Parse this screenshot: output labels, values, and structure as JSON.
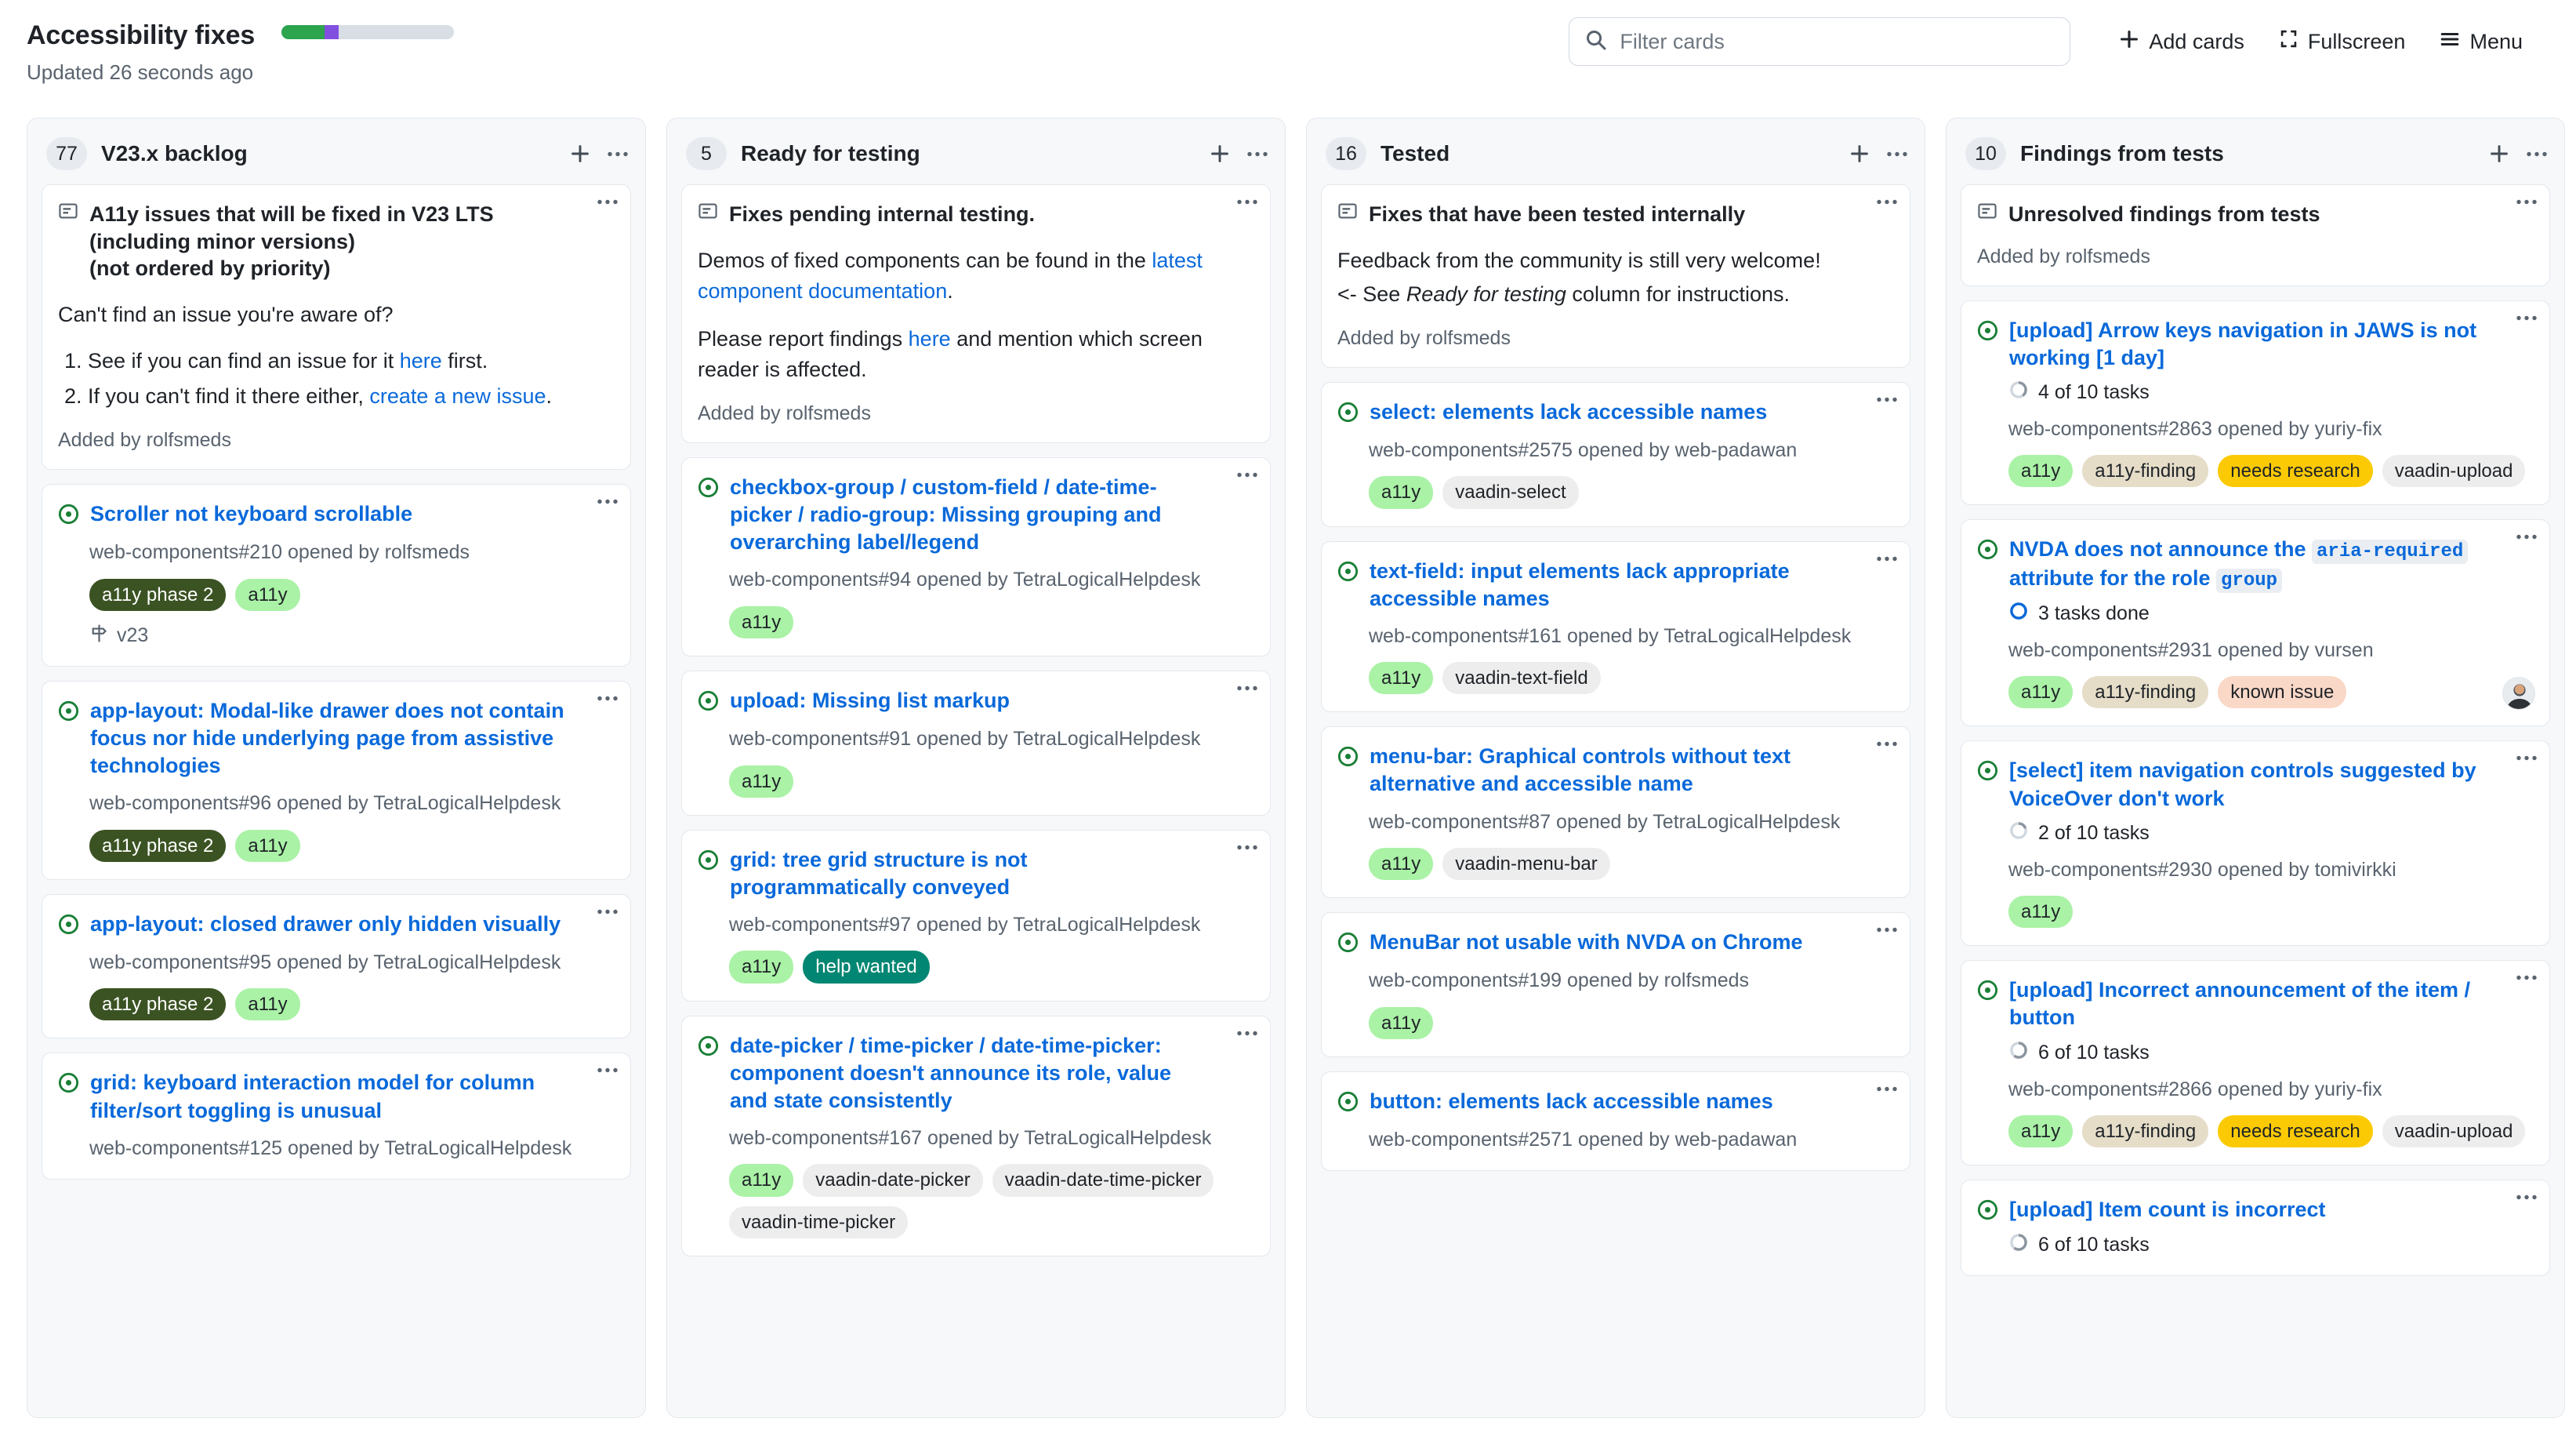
{
  "header": {
    "project_title": "Accessibility fixes",
    "updated_text": "Updated 26 seconds ago",
    "progress": [
      {
        "name": "done",
        "color": "#2da44e",
        "percent": 25
      },
      {
        "name": "in-progress",
        "color": "#8250df",
        "percent": 8
      },
      {
        "name": "remaining",
        "color": "#d8dee4",
        "percent": 67
      }
    ],
    "search": {
      "placeholder": "Filter cards",
      "value": ""
    },
    "add_cards_label": "Add cards",
    "fullscreen_label": "Fullscreen",
    "menu_label": "Menu"
  },
  "colors": {
    "link": "#0969da",
    "a11y_bg": "#aaf2a6",
    "a11y_phase2_bg": "#3b5323",
    "a11y_phase2_fg": "#ffffff",
    "help_wanted_bg": "#008672",
    "help_wanted_fg": "#ffffff",
    "a11y_finding_bg": "#e5ddc8",
    "needs_research_bg": "#fbca04",
    "known_issue_bg": "#fad8c7",
    "component_bg": "#ededed"
  },
  "columns": [
    {
      "count": "77",
      "name": "V23.x backlog",
      "cards": [
        {
          "type": "note",
          "title": "A11y issues that will be fixed in V23 LTS",
          "lines": [
            "(including minor versions)",
            "(not ordered by priority)"
          ],
          "question": "Can't find an issue you're aware of?",
          "list": [
            {
              "pre": "See if you can find an issue for it ",
              "link": "here",
              "post": " first."
            },
            {
              "pre": "If you can't find it there either, ",
              "link": "create a new issue",
              "post": "."
            }
          ],
          "added_by": "Added by rolfsmeds"
        },
        {
          "type": "issue",
          "title": "Scroller not keyboard scrollable",
          "meta": "web-components#210 opened by rolfsmeds",
          "labels": [
            {
              "text": "a11y phase 2",
              "style": "phase2"
            },
            {
              "text": "a11y",
              "style": "a11y"
            }
          ],
          "milestone": "v23"
        },
        {
          "type": "issue",
          "title": "app-layout: Modal-like drawer does not contain focus nor hide underlying page from assistive technologies",
          "meta": "web-components#96 opened by TetraLogicalHelpdesk",
          "labels": [
            {
              "text": "a11y phase 2",
              "style": "phase2"
            },
            {
              "text": "a11y",
              "style": "a11y"
            }
          ]
        },
        {
          "type": "issue",
          "title": "app-layout: closed drawer only hidden visually",
          "meta": "web-components#95 opened by TetraLogicalHelpdesk",
          "labels": [
            {
              "text": "a11y phase 2",
              "style": "phase2"
            },
            {
              "text": "a11y",
              "style": "a11y"
            }
          ]
        },
        {
          "type": "issue",
          "title": "grid: keyboard interaction model for column filter/sort toggling is unusual",
          "meta": "web-components#125 opened by TetraLogicalHelpdesk",
          "labels": []
        }
      ]
    },
    {
      "count": "5",
      "name": "Ready for testing",
      "cards": [
        {
          "type": "note",
          "title": "Fixes pending internal testing.",
          "lines": [],
          "para1_pre": "Demos of fixed components can be found in the ",
          "para1_link": "latest component documentation",
          "para1_post": ".",
          "para2_pre": "Please report findings ",
          "para2_link": "here",
          "para2_post": " and mention which screen reader is affected.",
          "added_by": "Added by rolfsmeds"
        },
        {
          "type": "issue",
          "title": "checkbox-group / custom-field / date-time-picker / radio-group: Missing grouping and overarching label/legend",
          "meta": "web-components#94 opened by TetraLogicalHelpdesk",
          "labels": [
            {
              "text": "a11y",
              "style": "a11y"
            }
          ]
        },
        {
          "type": "issue",
          "title": "upload: Missing list markup",
          "meta": "web-components#91 opened by TetraLogicalHelpdesk",
          "labels": [
            {
              "text": "a11y",
              "style": "a11y"
            }
          ]
        },
        {
          "type": "issue",
          "title": "grid: tree grid structure is not programmatically conveyed",
          "meta": "web-components#97 opened by TetraLogicalHelpdesk",
          "labels": [
            {
              "text": "a11y",
              "style": "a11y"
            },
            {
              "text": "help wanted",
              "style": "help"
            }
          ]
        },
        {
          "type": "issue",
          "title": "date-picker / time-picker / date-time-picker: component doesn't announce its role, value and state consistently",
          "meta": "web-components#167 opened by TetraLogicalHelpdesk",
          "labels": [
            {
              "text": "a11y",
              "style": "a11y"
            },
            {
              "text": "vaadin-date-picker",
              "style": "component"
            },
            {
              "text": "vaadin-date-time-picker",
              "style": "component"
            },
            {
              "text": "vaadin-time-picker",
              "style": "component"
            }
          ]
        }
      ]
    },
    {
      "count": "16",
      "name": "Tested",
      "cards": [
        {
          "type": "note",
          "title": "Fixes that have been tested internally",
          "lines": [],
          "plain1": "Feedback from the community is still very welcome!",
          "plain2_pre": "<- See ",
          "plain2_em": "Ready for testing",
          "plain2_post": " column for instructions.",
          "added_by": "Added by rolfsmeds"
        },
        {
          "type": "issue",
          "title": "select: elements lack accessible names",
          "meta": "web-components#2575 opened by web-padawan",
          "labels": [
            {
              "text": "a11y",
              "style": "a11y"
            },
            {
              "text": "vaadin-select",
              "style": "component"
            }
          ]
        },
        {
          "type": "issue",
          "title": "text-field: input elements lack appropriate accessible names",
          "meta": "web-components#161 opened by TetraLogicalHelpdesk",
          "labels": [
            {
              "text": "a11y",
              "style": "a11y"
            },
            {
              "text": "vaadin-text-field",
              "style": "component"
            }
          ]
        },
        {
          "type": "issue",
          "title": "menu-bar: Graphical controls without text alternative and accessible name",
          "meta": "web-components#87 opened by TetraLogicalHelpdesk",
          "labels": [
            {
              "text": "a11y",
              "style": "a11y"
            },
            {
              "text": "vaadin-menu-bar",
              "style": "component"
            }
          ]
        },
        {
          "type": "issue",
          "title": "MenuBar not usable with NVDA on Chrome",
          "meta": "web-components#199 opened by rolfsmeds",
          "labels": [
            {
              "text": "a11y",
              "style": "a11y"
            }
          ]
        },
        {
          "type": "issue",
          "title": "button: elements lack accessible names",
          "meta": "web-components#2571 opened by web-padawan",
          "labels": []
        }
      ]
    },
    {
      "count": "10",
      "name": "Findings from tests",
      "cards": [
        {
          "type": "note",
          "title": "Unresolved findings from tests",
          "lines": [],
          "added_by": "Added by rolfsmeds"
        },
        {
          "type": "issue",
          "title": "[upload] Arrow keys navigation in JAWS is not working [1 day]",
          "tasks": "4 of 10 tasks",
          "tasks_progress": 40,
          "meta": "web-components#2863 opened by yuriy-fix",
          "labels": [
            {
              "text": "a11y",
              "style": "a11y"
            },
            {
              "text": "a11y-finding",
              "style": "finding"
            },
            {
              "text": "needs research",
              "style": "research"
            },
            {
              "text": "vaadin-upload",
              "style": "component"
            }
          ]
        },
        {
          "type": "issue",
          "title_parts": [
            {
              "t": "NVDA does not announce the ",
              "code": false
            },
            {
              "t": "aria-required",
              "code": true
            },
            {
              "t": " attribute for the role ",
              "code": false
            },
            {
              "t": "group",
              "code": true
            }
          ],
          "title": "NVDA does not announce the aria-required attribute for the role group",
          "tasks": "3 tasks done",
          "tasks_progress": 100,
          "meta": "web-components#2931 opened by vursen",
          "labels": [
            {
              "text": "a11y",
              "style": "a11y"
            },
            {
              "text": "a11y-finding",
              "style": "finding"
            },
            {
              "text": "known issue",
              "style": "known"
            }
          ],
          "has_avatar": true
        },
        {
          "type": "issue",
          "title": "[select] item navigation controls suggested by VoiceOver don't work",
          "tasks": "2 of 10 tasks",
          "tasks_progress": 20,
          "meta": "web-components#2930 opened by tomivirkki",
          "labels": [
            {
              "text": "a11y",
              "style": "a11y"
            }
          ]
        },
        {
          "type": "issue",
          "title": "[upload] Incorrect announcement of the item / button",
          "tasks": "6 of 10 tasks",
          "tasks_progress": 60,
          "meta": "web-components#2866 opened by yuriy-fix",
          "labels": [
            {
              "text": "a11y",
              "style": "a11y"
            },
            {
              "text": "a11y-finding",
              "style": "finding"
            },
            {
              "text": "needs research",
              "style": "research"
            },
            {
              "text": "vaadin-upload",
              "style": "component"
            }
          ]
        },
        {
          "type": "issue",
          "title": "[upload] Item count is incorrect",
          "tasks": "6 of 10 tasks",
          "tasks_progress": 60,
          "meta": "",
          "labels": []
        }
      ]
    }
  ]
}
